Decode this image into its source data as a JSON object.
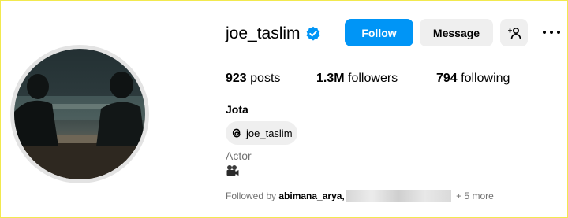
{
  "profile": {
    "username": "joe_taslim",
    "verified": true,
    "full_name": "Jota",
    "category": "Actor",
    "threads_handle": "joe_taslim",
    "bio_emoji_icon": "movie-camera-icon"
  },
  "actions": {
    "follow_label": "Follow",
    "message_label": "Message",
    "add_user_icon": "add-user-icon",
    "more_icon": "more-options-icon"
  },
  "stats": {
    "posts_count": "923",
    "posts_label": "posts",
    "followers_count": "1.3M",
    "followers_label": "followers",
    "following_count": "794",
    "following_label": "following"
  },
  "followed_by": {
    "prefix": "Followed by ",
    "first_name": "abimana_arya,",
    "suffix": "+ 5 more"
  },
  "colors": {
    "follow_button": "#0095f6",
    "secondary_button": "#efefef",
    "verified_badge": "#0095f6",
    "muted_text": "#737373"
  }
}
